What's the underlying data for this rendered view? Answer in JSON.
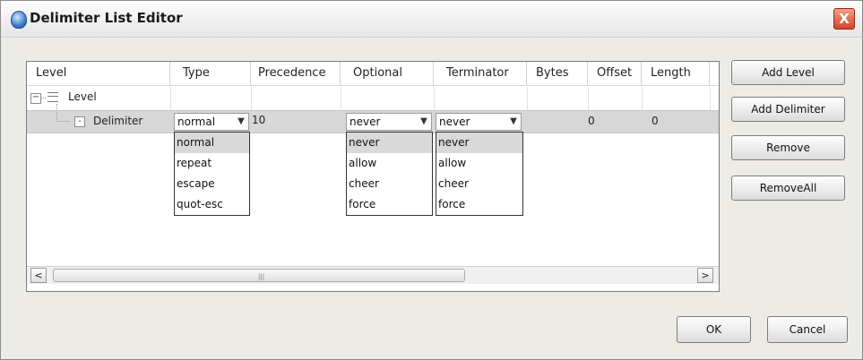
{
  "window": {
    "title": "Delimiter List Editor",
    "close_glyph": "X"
  },
  "table": {
    "columns": [
      "Level",
      "Type",
      "Precedence",
      "Optional",
      "Terminator",
      "Bytes",
      "Offset",
      "Length"
    ],
    "rows": {
      "level": {
        "label": "Level"
      },
      "delimiter": {
        "label": "Delimiter",
        "type_value": "normal",
        "precedence": "10",
        "optional_value": "never",
        "terminator_value": "never",
        "bytes": "",
        "offset": "0",
        "length": "0"
      }
    },
    "type_options": [
      "normal",
      "repeat",
      "escape",
      "quot-esc"
    ],
    "optional_options": [
      "never",
      "allow",
      "cheer",
      "force"
    ],
    "terminator_options": [
      "never",
      "allow",
      "cheer",
      "force"
    ]
  },
  "scrollbar": {
    "left_arrow": "<",
    "right_arrow": ">",
    "grip": "|||"
  },
  "side_buttons": {
    "add_level": "Add Level",
    "add_delimiter": "Add Delimiter",
    "remove": "Remove",
    "remove_all": "RemoveAll"
  },
  "footer": {
    "ok": "OK",
    "cancel": "Cancel"
  },
  "colors": {
    "selected_row": "#d7d7d7",
    "dialog_bg": "#ecebe6",
    "close_button": "#d4452a"
  }
}
